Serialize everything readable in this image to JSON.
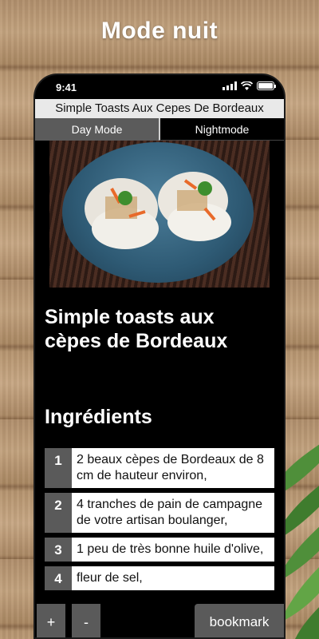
{
  "banner": {
    "title": "Mode nuit"
  },
  "status": {
    "time": "9:41"
  },
  "app": {
    "title": "Simple Toasts Aux Cepes De Bordeaux",
    "modes": {
      "day": "Day Mode",
      "night": "Nightmode"
    }
  },
  "recipe": {
    "title": "Simple toasts aux cèpes de Bordeaux",
    "ingredients_heading": "Ingrédients",
    "ingredients": [
      {
        "num": "1",
        "text": "2 beaux cèpes de Bordeaux de 8 cm de hauteur environ,"
      },
      {
        "num": "2",
        "text": "4 tranches de pain de campagne de votre artisan boulanger,"
      },
      {
        "num": "3",
        "text": "1 peu de très bonne huile d'olive,"
      },
      {
        "num": "4",
        "text": "fleur de sel,"
      }
    ]
  },
  "controls": {
    "plus": "+",
    "minus": "-",
    "bookmark": "bookmark"
  },
  "colors": {
    "accent_gray": "#5a5a5a",
    "night_bg": "#000000",
    "title_bar": "#e9e9e9"
  }
}
